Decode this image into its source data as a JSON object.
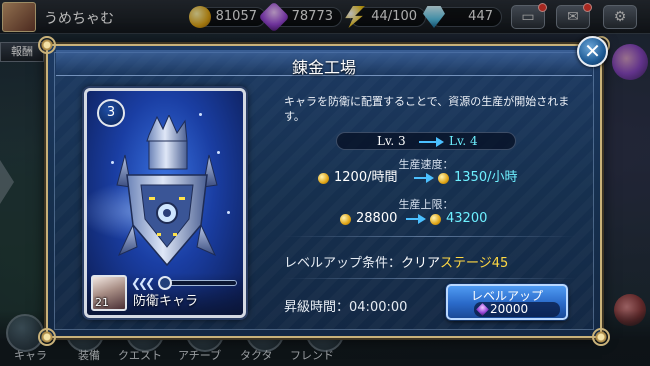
{
  "header": {
    "username": "うめちゃむ",
    "gold": "81057",
    "gems": "78773",
    "stamina": "44/100",
    "diamonds": "447",
    "side_tab": "報酬"
  },
  "bottom_nav": {
    "items": [
      "キャラ",
      "装備",
      "クエスト",
      "アチーブ",
      "タクタ",
      "フレンド"
    ]
  },
  "dialog": {
    "title": "錬金工場",
    "close_glyph": "✕",
    "card": {
      "level": "3",
      "char_level": "21",
      "chevrons": "❮❮❮",
      "label": "防衛キャラ",
      "gauge_progress": 0
    },
    "description": "キャラを防衛に配置することで、資源の生産が開始されます。",
    "level_change": {
      "old": "Lv. 3",
      "new": "Lv. 4"
    },
    "production_speed": {
      "title": "生産速度：",
      "old": "1200/時間",
      "new": "1350/小時"
    },
    "production_cap": {
      "title": "生産上限：",
      "old": "28800",
      "new": "43200"
    },
    "condition": {
      "label": "レベルアップ条件：",
      "value": "クリア",
      "stage": "ステージ45"
    },
    "upgrade_time": {
      "label": "昇級時間：",
      "value": "04:00:00"
    },
    "upgrade_button": {
      "label": "レベルアップ",
      "cost": "20000"
    }
  },
  "colors": {
    "accent_cyan": "#6ef0ff",
    "stage_yellow": "#ffd843",
    "frame_gold": "#c9b27a"
  }
}
